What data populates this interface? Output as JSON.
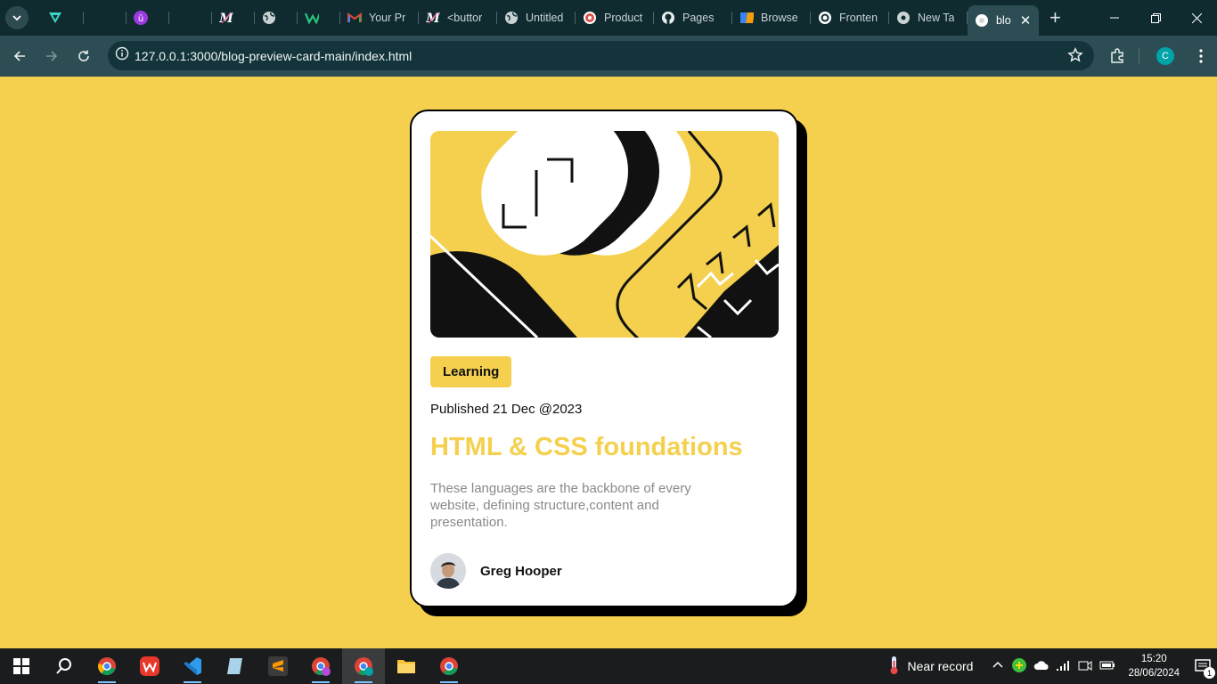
{
  "browser": {
    "tabs": [
      {
        "icon": "v-logo-icon",
        "label": ""
      },
      {
        "icon": "blank-icon",
        "label": ""
      },
      {
        "icon": "ublock-icon",
        "label": ""
      },
      {
        "icon": "blank-icon",
        "label": ""
      },
      {
        "icon": "m-logo-icon",
        "label": ""
      },
      {
        "icon": "globe-icon",
        "label": ""
      },
      {
        "icon": "w-logo-icon",
        "label": ""
      },
      {
        "icon": "gmail-icon",
        "label": "Your Pr"
      },
      {
        "icon": "m-logo-icon",
        "label": "<buttor"
      },
      {
        "icon": "globe-icon",
        "label": "Untitled"
      },
      {
        "icon": "record-icon",
        "label": "Product"
      },
      {
        "icon": "github-icon",
        "label": "Pages"
      },
      {
        "icon": "grid-logo-icon",
        "label": "Browse"
      },
      {
        "icon": "frontend-icon",
        "label": "Fronten"
      },
      {
        "icon": "chrome-icon",
        "label": "New Ta"
      }
    ],
    "active_tab": {
      "label": "blo"
    },
    "url": "127.0.0.1:3000/blog-preview-card-main/index.html",
    "profile_initial": "C"
  },
  "card": {
    "tag": "Learning",
    "published": "Published 21 Dec @2023",
    "title": "HTML & CSS foundations",
    "description": "These languages are the backbone of every website, defining structure,content and presentation.",
    "author": "Greg Hooper"
  },
  "taskbar": {
    "weather": "Near record",
    "time": "15:20",
    "date": "28/06/2024",
    "notifications": "1"
  },
  "colors": {
    "accent": "#f4d04e",
    "ink": "#111111",
    "muted": "#8a8a8a",
    "tabbar": "#0f2b30",
    "toolbar": "#2b4d53"
  }
}
